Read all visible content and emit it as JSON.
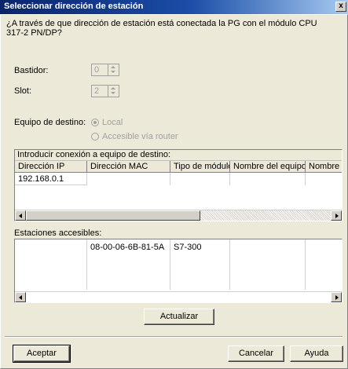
{
  "window": {
    "title": "Seleccionar dirección de estación",
    "close_glyph": "x",
    "question": "¿A través de que dirección de estación está conectada la PG con el módulo CPU 317-2 PN/DP?"
  },
  "rack": {
    "label": "Bastidor:",
    "value": "0"
  },
  "slot": {
    "label": "Slot:",
    "value": "2"
  },
  "target": {
    "label": "Equipo de destino:",
    "options": [
      {
        "label": "Local",
        "selected": true
      },
      {
        "label": "Accesible vía router",
        "selected": false
      }
    ]
  },
  "connection_table": {
    "group_title": "Introducir conexión a equipo de destino:",
    "columns": [
      "Dirección IP",
      "Dirección MAC",
      "Tipo de módulo",
      "Nombre del equipo",
      "Nombre de"
    ],
    "rows": [
      [
        "192.168.0.1",
        "",
        "",
        "",
        ""
      ]
    ]
  },
  "accessible": {
    "label": "Estaciones accesibles:",
    "rows": [
      [
        "",
        "08-00-06-6B-81-5A",
        "S7-300",
        "",
        ""
      ]
    ]
  },
  "buttons": {
    "refresh": "Actualizar",
    "accept": "Aceptar",
    "cancel": "Cancelar",
    "help": "Ayuda"
  },
  "icons": {
    "close": "close-icon",
    "spin_up": "arrow-up-icon",
    "spin_down": "arrow-down-icon",
    "scroll_left": "arrow-left-icon",
    "scroll_right": "arrow-right-icon"
  }
}
